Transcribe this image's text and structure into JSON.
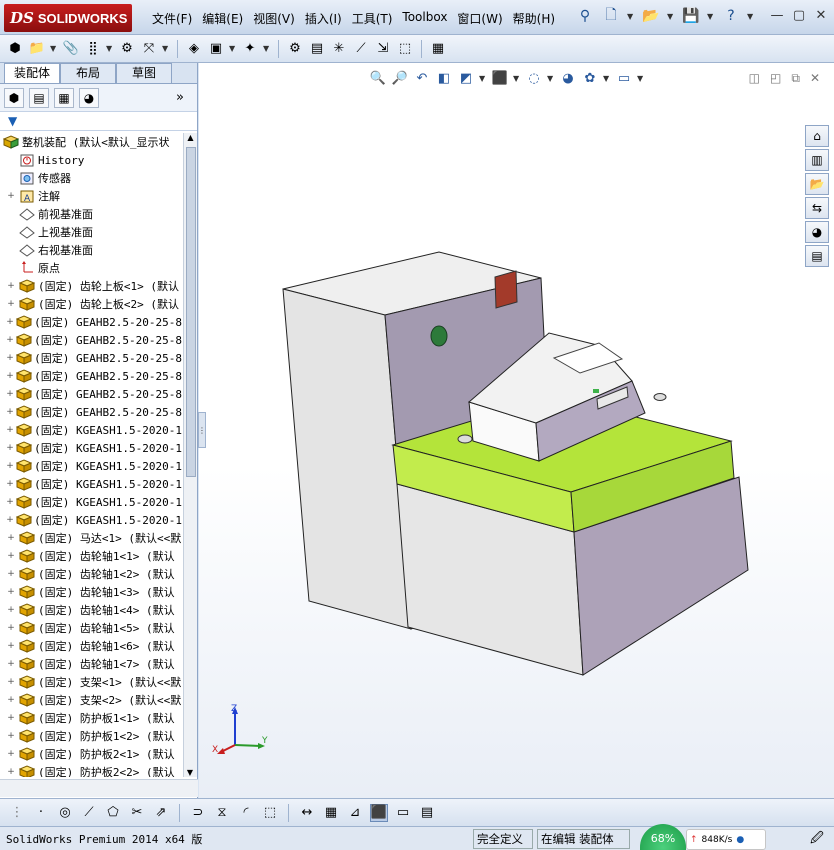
{
  "app": {
    "logo_ds": "DS",
    "logo_text": "SOLIDWORKS"
  },
  "menu": [
    "文件(F)",
    "编辑(E)",
    "视图(V)",
    "插入(I)",
    "工具(T)",
    "Toolbox",
    "窗口(W)",
    "帮助(H)"
  ],
  "panel": {
    "tabs": [
      "装配体",
      "布局",
      "草图"
    ],
    "active_tab": "装配体",
    "more_glyph": "»"
  },
  "tree": {
    "root": "整机装配  (默认<默认_显示状",
    "items": [
      {
        "expander": "",
        "icon": "history-icon",
        "text": "History"
      },
      {
        "expander": "",
        "icon": "sensor-icon",
        "text": "传感器"
      },
      {
        "expander": "+",
        "icon": "annotation-icon",
        "text": "注解"
      },
      {
        "expander": "",
        "icon": "plane-icon",
        "text": "前视基准面"
      },
      {
        "expander": "",
        "icon": "plane-icon",
        "text": "上视基准面"
      },
      {
        "expander": "",
        "icon": "plane-icon",
        "text": "右视基准面"
      },
      {
        "expander": "",
        "icon": "origin-icon",
        "text": "原点"
      },
      {
        "expander": "+",
        "icon": "part-icon",
        "text": "(固定) 齿轮上板<1> (默认"
      },
      {
        "expander": "+",
        "icon": "part-icon",
        "text": "(固定) 齿轮上板<2> (默认"
      },
      {
        "expander": "+",
        "icon": "part-icon",
        "text": "(固定) GEAHB2.5-20-25-8"
      },
      {
        "expander": "+",
        "icon": "part-icon",
        "text": "(固定) GEAHB2.5-20-25-8"
      },
      {
        "expander": "+",
        "icon": "part-icon",
        "text": "(固定) GEAHB2.5-20-25-8"
      },
      {
        "expander": "+",
        "icon": "part-icon",
        "text": "(固定) GEAHB2.5-20-25-8"
      },
      {
        "expander": "+",
        "icon": "part-icon",
        "text": "(固定) GEAHB2.5-20-25-8"
      },
      {
        "expander": "+",
        "icon": "part-icon",
        "text": "(固定) GEAHB2.5-20-25-8"
      },
      {
        "expander": "+",
        "icon": "part-icon",
        "text": "(固定) KGEASH1.5-2020-1"
      },
      {
        "expander": "+",
        "icon": "part-icon",
        "text": "(固定) KGEASH1.5-2020-1"
      },
      {
        "expander": "+",
        "icon": "part-icon",
        "text": "(固定) KGEASH1.5-2020-1"
      },
      {
        "expander": "+",
        "icon": "part-icon",
        "text": "(固定) KGEASH1.5-2020-1"
      },
      {
        "expander": "+",
        "icon": "part-icon",
        "text": "(固定) KGEASH1.5-2020-1"
      },
      {
        "expander": "+",
        "icon": "part-icon",
        "text": "(固定) KGEASH1.5-2020-1"
      },
      {
        "expander": "+",
        "icon": "part-icon",
        "text": "(固定) 马达<1> (默认<<默"
      },
      {
        "expander": "+",
        "icon": "part-icon",
        "text": "(固定) 齿轮轴1<1> (默认"
      },
      {
        "expander": "+",
        "icon": "part-icon",
        "text": "(固定) 齿轮轴1<2> (默认"
      },
      {
        "expander": "+",
        "icon": "part-icon",
        "text": "(固定) 齿轮轴1<3> (默认"
      },
      {
        "expander": "+",
        "icon": "part-icon",
        "text": "(固定) 齿轮轴1<4> (默认"
      },
      {
        "expander": "+",
        "icon": "part-icon",
        "text": "(固定) 齿轮轴1<5> (默认"
      },
      {
        "expander": "+",
        "icon": "part-icon",
        "text": "(固定) 齿轮轴1<6> (默认"
      },
      {
        "expander": "+",
        "icon": "part-icon",
        "text": "(固定) 齿轮轴1<7> (默认"
      },
      {
        "expander": "+",
        "icon": "part-icon",
        "text": "(固定) 支架<1> (默认<<默"
      },
      {
        "expander": "+",
        "icon": "part-icon",
        "text": "(固定) 支架<2> (默认<<默"
      },
      {
        "expander": "+",
        "icon": "part-icon",
        "text": "(固定) 防护板1<1> (默认"
      },
      {
        "expander": "+",
        "icon": "part-icon",
        "text": "(固定) 防护板1<2> (默认"
      },
      {
        "expander": "+",
        "icon": "part-icon",
        "text": "(固定) 防护板2<1> (默认"
      },
      {
        "expander": "+",
        "icon": "part-icon",
        "text": "(固定) 防护板2<2> (默认"
      }
    ]
  },
  "triad": {
    "x": "X",
    "y": "Y",
    "z": "Z"
  },
  "status": {
    "product": "SolidWorks Premium 2014 x64 版",
    "definition": "完全定义",
    "mode": "在编辑 装配体"
  },
  "network": {
    "percent": "68%",
    "speed": "848K/s"
  },
  "colors": {
    "accent": "#c81e1e",
    "top_plate": "#b4e43a",
    "housing_side": "#a29aae",
    "housing_face": "#e6e6e6",
    "indicator_red": "#a33a2a",
    "indicator_green": "#2d7a3a"
  }
}
